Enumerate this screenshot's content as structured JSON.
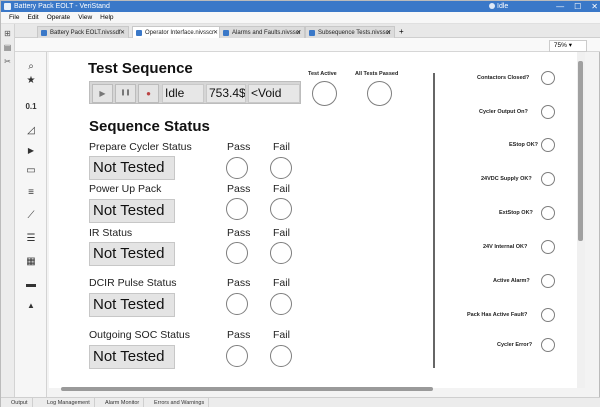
{
  "window": {
    "title": "Battery Pack EOLT - VeriStand",
    "user": "Idle",
    "minimize": "—",
    "maximize": "☐",
    "close": "✕"
  },
  "menu": [
    "File",
    "Edit",
    "Operate",
    "View",
    "Help"
  ],
  "tabs": [
    {
      "label": "Battery Pack EOLT.nivssdf",
      "close": "✕",
      "active": false
    },
    {
      "label": "Operator Interface.nivsscr",
      "close": "✕",
      "active": true
    },
    {
      "label": "Alarms and Faults.nivsscr",
      "close": "✕",
      "active": false
    },
    {
      "label": "Subsequence Tests.nivsscr",
      "close": "✕",
      "active": false
    }
  ],
  "add_tab": "+",
  "toolbar": {
    "zoom": "75%",
    "zoom_caret": "▾"
  },
  "left_strip_icons": [
    "⊞",
    "▤",
    "✂"
  ],
  "palette": {
    "icons": [
      "search-icon",
      "favorite-icon",
      "numeric-indicator-icon",
      "gauge-icon",
      "play-icon",
      "button-icon",
      "list-icon",
      "graph-icon",
      "table-icon",
      "calendar-icon",
      "vehicle-icon",
      "shapes-icon"
    ],
    "glyphs": [
      "⌕",
      "★",
      "0.1",
      "◿",
      "▶",
      "▭",
      "≡",
      "⟋",
      "☰",
      "▦",
      "▬",
      "▲"
    ]
  },
  "test_sequence": {
    "title": "Test Sequence",
    "play": "▶",
    "pause": "❚❚",
    "stop": "●",
    "state": "Idle",
    "value": "753.4$",
    "void": "<Void",
    "test_active_label": "Test Active",
    "all_tests_passed_label": "All Tests Passed"
  },
  "sequence_status": {
    "title": "Sequence Status",
    "pass_label": "Pass",
    "fail_label": "Fail",
    "items": [
      {
        "name": "Prepare Cycler Status",
        "status": "Not Tested"
      },
      {
        "name": "Power Up Pack",
        "status": "Not Tested"
      },
      {
        "name": "IR Status",
        "status": "Not Tested"
      },
      {
        "name": "DCIR Pulse Status",
        "status": "Not Tested"
      },
      {
        "name": "Outgoing SOC Status",
        "status": "Not Tested"
      }
    ]
  },
  "right_indicators": [
    "Contactors Closed?",
    "Cycler Output On?",
    "EStop OK?",
    "24VDC Supply OK?",
    "ExtStop OK?",
    "24V Internal OK?",
    "Active Alarm?",
    "Pack Has Active Fault?",
    "Cycler Error?"
  ],
  "bottom_tabs": [
    "Output",
    "Log Management",
    "Alarm Monitor",
    "Errors and Warnings"
  ]
}
